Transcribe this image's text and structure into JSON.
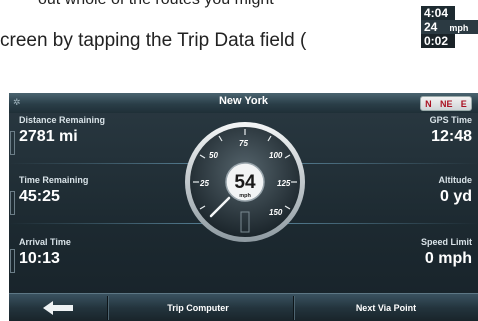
{
  "document": {
    "line1": "out whole of the routes you might",
    "line2": "creen by tapping the Trip Data field ("
  },
  "mini_field": {
    "time": "4:04",
    "speed": "24",
    "speed_unit": "mph",
    "elapsed": "0:02"
  },
  "screen": {
    "title": "New York",
    "compass_letters": [
      "N",
      "NE",
      "E"
    ],
    "left_fields": [
      {
        "label": "Distance Remaining",
        "value": "2781  mi"
      },
      {
        "label": "Time Remaining",
        "value": "45:25"
      },
      {
        "label": "Arrival Time",
        "value": "10:13"
      }
    ],
    "right_fields": [
      {
        "label": "GPS Time",
        "value": "12:48"
      },
      {
        "label": "Altitude",
        "value": "0  yd"
      },
      {
        "label": "Speed Limit",
        "value": "0 mph"
      }
    ],
    "speedometer": {
      "speed": "54",
      "unit": "mph",
      "scale_labels": [
        "25",
        "50",
        "75",
        "100",
        "125",
        "150"
      ]
    },
    "bottom_bar": {
      "back_icon": "back-arrow-icon",
      "center_label": "Trip Computer",
      "right_label": "Next Via Point"
    }
  }
}
